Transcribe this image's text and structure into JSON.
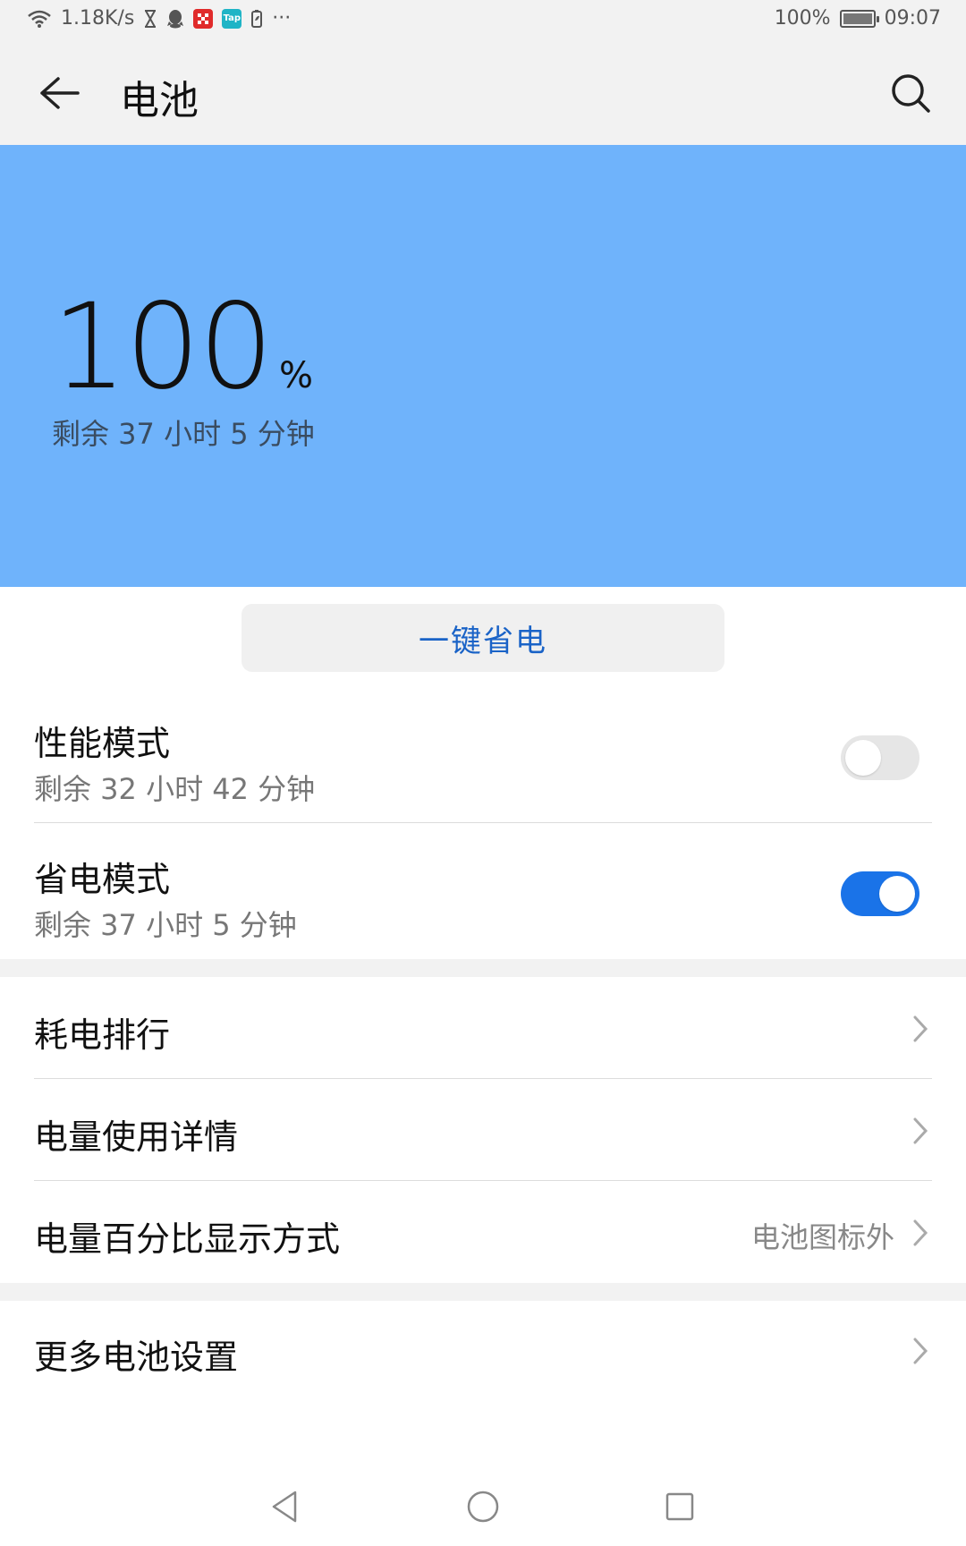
{
  "status_bar": {
    "network_speed": "1.18K/s",
    "more": "···",
    "battery_percent": "100%",
    "time": "09:07",
    "icons": [
      "wifi-icon",
      "hourglass-icon",
      "qq-icon",
      "red-app-icon",
      "tap-app-icon",
      "battery-saver-icon"
    ],
    "tap_badge": "Tap"
  },
  "header": {
    "title": "电池"
  },
  "hero": {
    "percent": "100",
    "unit": "%",
    "remaining": "剩余 37 小时 5 分钟",
    "background_color": "#6fb3fb"
  },
  "save_button": {
    "label": "一键省电"
  },
  "modes": [
    {
      "title": "性能模式",
      "subtitle": "剩余 32 小时 42 分钟",
      "enabled": false
    },
    {
      "title": "省电模式",
      "subtitle": "剩余 37 小时 5 分钟",
      "enabled": true
    }
  ],
  "menu": [
    {
      "label": "耗电排行",
      "value": ""
    },
    {
      "label": "电量使用详情",
      "value": ""
    },
    {
      "label": "电量百分比显示方式",
      "value": "电池图标外"
    }
  ],
  "more_settings": {
    "label": "更多电池设置"
  },
  "colors": {
    "accent": "#1a73e8",
    "save_text": "#1a63c7"
  }
}
